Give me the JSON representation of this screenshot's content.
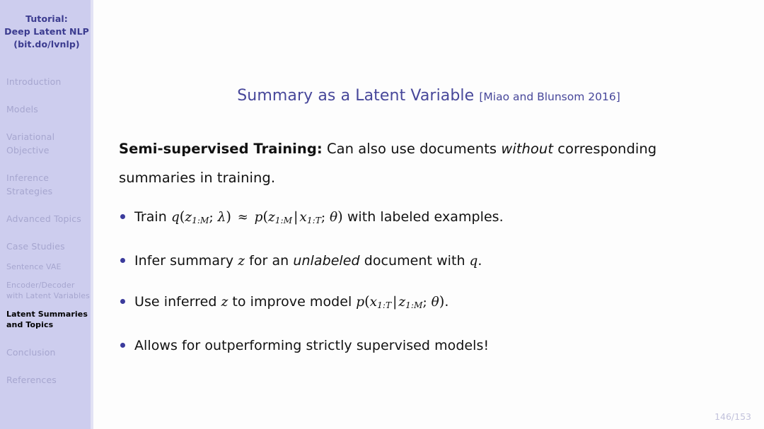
{
  "sidebar": {
    "title_lines": [
      "Tutorial:",
      "Deep Latent NLP",
      "(bit.do/lvnlp)"
    ],
    "sections": [
      {
        "label": "Introduction"
      },
      {
        "label": "Models"
      },
      {
        "label": "Variational Objective"
      },
      {
        "label": "Inference Strategies"
      },
      {
        "label": "Advanced Topics"
      },
      {
        "label": "Case Studies"
      }
    ],
    "subsections": [
      {
        "label": "Sentence VAE",
        "current": false
      },
      {
        "label": "Encoder/Decoder with Latent Variables",
        "current": false
      },
      {
        "label": "Latent Summaries and Topics",
        "current": true
      }
    ],
    "tail_sections": [
      {
        "label": "Conclusion"
      },
      {
        "label": "References"
      }
    ]
  },
  "slide": {
    "title": "Summary as a Latent Variable",
    "citation": "[Miao and Blunsom 2016]",
    "lead": {
      "bold_prefix": "Semi-supervised Training:",
      "text_before_italic": " Can also use documents ",
      "italic": "without",
      "text_after_italic": " corresponding summaries in training."
    },
    "bullets": [
      {
        "id": "bullet-train",
        "parts": [
          {
            "kind": "text",
            "value": "Train "
          },
          {
            "kind": "math",
            "value": "q(z_{1:M}; λ) ≈ p(z_{1:M} | x_{1:T}; θ)"
          },
          {
            "kind": "text",
            "value": " with labeled examples."
          }
        ],
        "plain": "Train q(z_{1:M}; λ) ≈ p(z_{1:M} | x_{1:T}; θ) with labeled examples."
      },
      {
        "id": "bullet-infer",
        "parts": [
          {
            "kind": "text",
            "value": "Infer summary "
          },
          {
            "kind": "math",
            "value": "z"
          },
          {
            "kind": "text",
            "value": " for an "
          },
          {
            "kind": "italic",
            "value": "unlabeled"
          },
          {
            "kind": "text",
            "value": " document with "
          },
          {
            "kind": "math",
            "value": "q"
          },
          {
            "kind": "text",
            "value": "."
          }
        ],
        "plain": "Infer summary z for an unlabeled document with q."
      },
      {
        "id": "bullet-improve",
        "parts": [
          {
            "kind": "text",
            "value": "Use inferred "
          },
          {
            "kind": "math",
            "value": "z"
          },
          {
            "kind": "text",
            "value": " to improve model "
          },
          {
            "kind": "math",
            "value": "p(x_{1:T} | z_{1:M}; θ)"
          },
          {
            "kind": "text",
            "value": "."
          }
        ],
        "plain": "Use inferred z to improve model p(x_{1:T} | z_{1:M}; θ)."
      },
      {
        "id": "bullet-outperform",
        "parts": [
          {
            "kind": "text",
            "value": "Allows for outperforming strictly supervised models!"
          }
        ],
        "plain": "Allows for outperforming strictly supervised models!"
      }
    ],
    "page_number": "146/153"
  },
  "colors": {
    "sidebar_bg": "#cdcdee",
    "sidebar_title": "#3b3b8f",
    "sidebar_inactive": "#a6a6cf",
    "sidebar_active": "#000000",
    "slide_title": "#47479a",
    "bullet_dot": "#3b3b9c",
    "page_number": "#c2c2dc",
    "body_text": "#111111",
    "background": "#fdfdfd"
  },
  "math_literals": {
    "train_q": "q",
    "train_z": "z",
    "train_sub_1M": "1:M",
    "train_lambda": "λ",
    "approx": "≈",
    "train_p": "p",
    "train_x": "x",
    "train_sub_1T": "1:T",
    "theta": "θ",
    "mid": "|",
    "semicolon": ";"
  }
}
